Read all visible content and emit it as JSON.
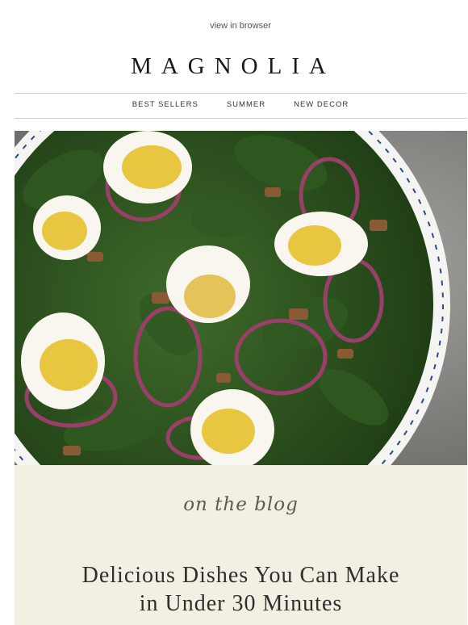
{
  "header": {
    "view_in_browser": "view in browser",
    "logo": "MAGNOLIA"
  },
  "nav": {
    "items": [
      "BEST SELLERS",
      "SUMMER",
      "NEW DECOR"
    ]
  },
  "hero": {
    "image_alt": "spinach salad with eggs"
  },
  "promo": {
    "kicker": "on the blog",
    "headline_line1": "Delicious Dishes You Can Make",
    "headline_line2": "in Under 30 Minutes"
  },
  "colors": {
    "promo_background": "#f3efe3",
    "rule": "#cfcfcf",
    "text": "#222222"
  }
}
